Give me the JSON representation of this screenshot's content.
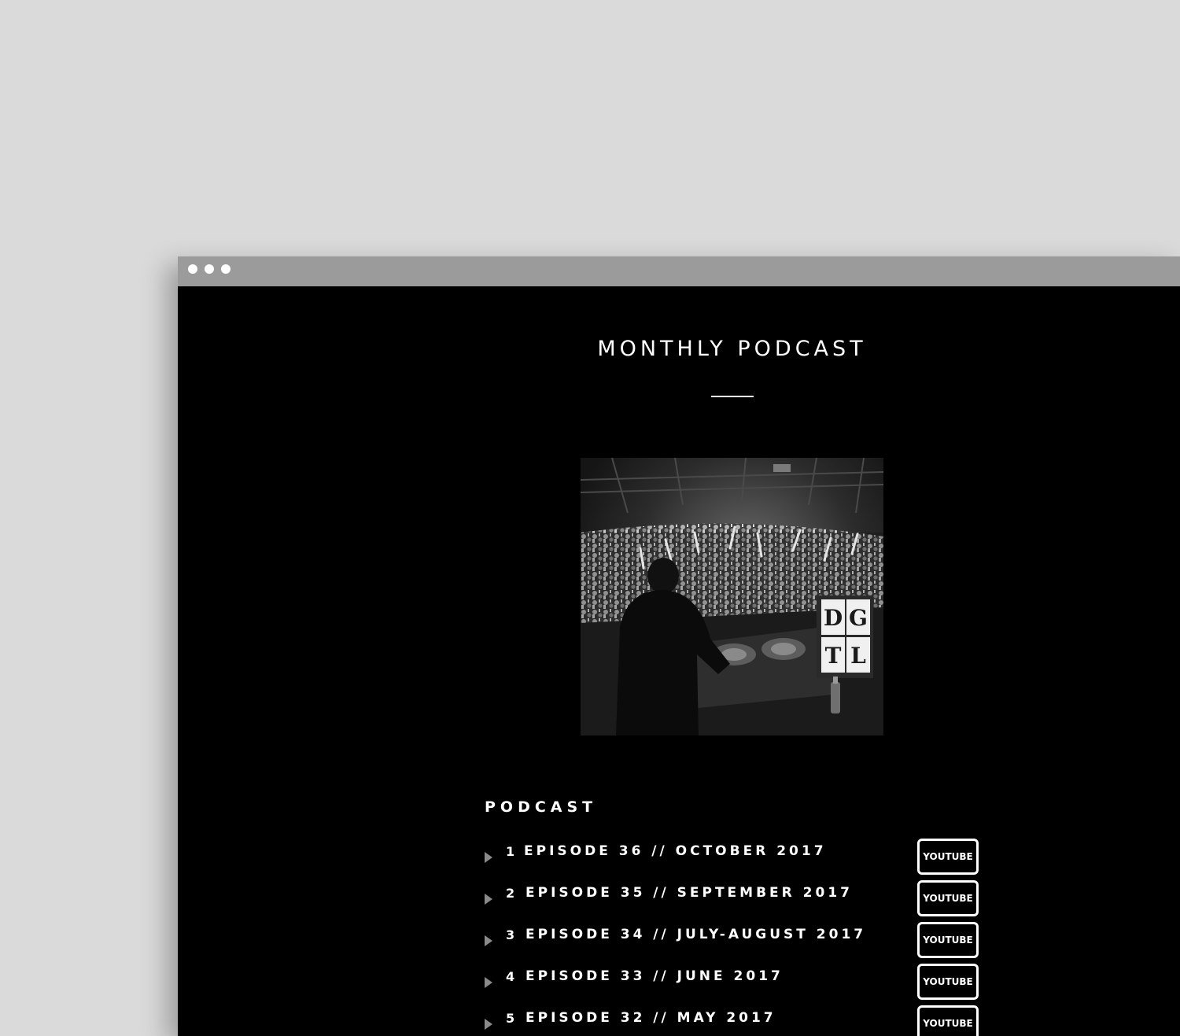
{
  "page": {
    "title": "MONTHLY PODCAST",
    "section_heading": "PODCAST"
  },
  "episodes": [
    {
      "number": "1",
      "title": "EPISODE 36 // OCTOBER 2017",
      "button": "YOUTUBE"
    },
    {
      "number": "2",
      "title": "EPISODE 35 // SEPTEMBER 2017",
      "button": "YOUTUBE"
    },
    {
      "number": "3",
      "title": "EPISODE 34 // JULY-AUGUST 2017",
      "button": "YOUTUBE"
    },
    {
      "number": "4",
      "title": "EPISODE 33 // JUNE 2017",
      "button": "YOUTUBE"
    },
    {
      "number": "5",
      "title": "EPISODE 32 // MAY 2017",
      "button": "YOUTUBE"
    }
  ],
  "image": {
    "logo_letters": [
      "D",
      "G",
      "T",
      "L"
    ]
  },
  "colors": {
    "page_bg": "#000000",
    "outer_bg": "#dadada",
    "browser_bar": "#9b9b9b",
    "text": "#ffffff",
    "play_icon": "#8a8a8a"
  },
  "icons": {
    "play": "play-triangle-icon",
    "window_controls": "window-dot-icon"
  }
}
